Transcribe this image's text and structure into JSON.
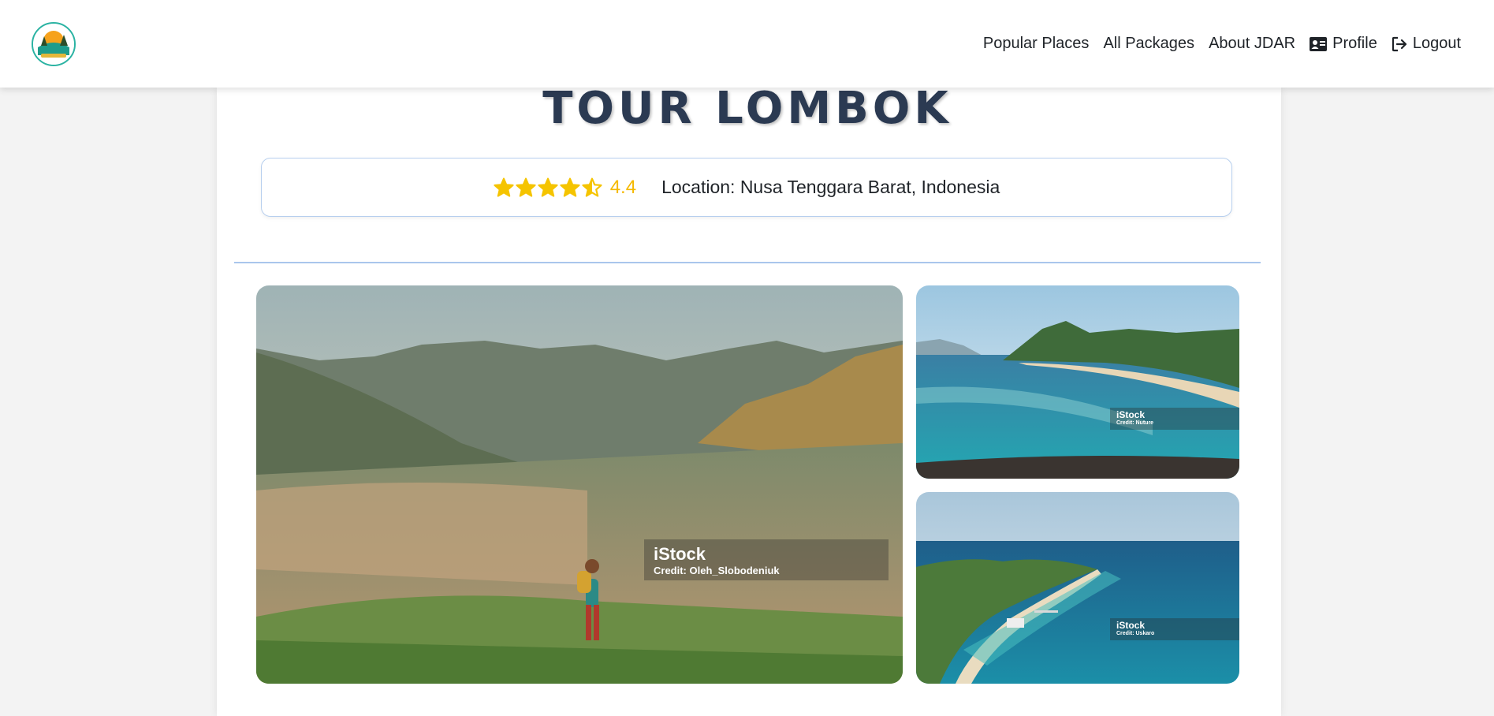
{
  "nav": {
    "links": [
      {
        "label": "Popular Places"
      },
      {
        "label": "All Packages"
      },
      {
        "label": "About JDAR"
      },
      {
        "label": "Profile",
        "icon": "id-card-icon"
      },
      {
        "label": "Logout",
        "icon": "logout-icon"
      }
    ]
  },
  "tour": {
    "title": "TOUR LOMBOK",
    "rating": "4.4",
    "rating_value": 4.4,
    "location": "Location: Nusa Tenggara Barat, Indonesia"
  },
  "gallery": {
    "photos": [
      {
        "brand": "iStock",
        "credit": "Credit: Oleh_Slobodeniuk"
      },
      {
        "brand": "iStock",
        "credit": "Credit: Nuture"
      },
      {
        "brand": "iStock",
        "credit": "Credit: Uskaro"
      }
    ]
  },
  "colors": {
    "star": "#f5c400",
    "title": "#2b3a52",
    "accent_border": "#a9c6ec"
  }
}
